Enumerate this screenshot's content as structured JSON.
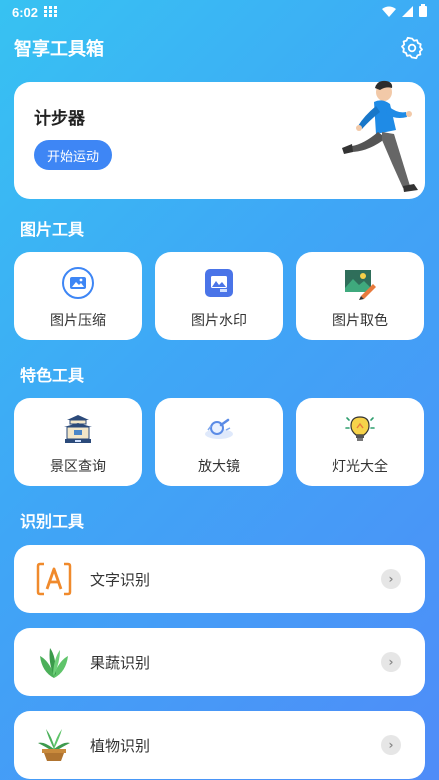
{
  "status_bar": {
    "time": "6:02"
  },
  "header": {
    "title": "智享工具箱",
    "settings_icon": "gear-icon"
  },
  "pedometer": {
    "title": "计步器",
    "button_label": "开始运动"
  },
  "image_tools": {
    "title": "图片工具",
    "items": [
      {
        "label": "图片压缩",
        "icon": "image-compress-icon"
      },
      {
        "label": "图片水印",
        "icon": "image-watermark-icon"
      },
      {
        "label": "图片取色",
        "icon": "color-picker-icon"
      }
    ]
  },
  "special_tools": {
    "title": "特色工具",
    "items": [
      {
        "label": "景区查询",
        "icon": "temple-icon"
      },
      {
        "label": "放大镜",
        "icon": "magnifier-icon"
      },
      {
        "label": "灯光大全",
        "icon": "lightbulb-icon"
      }
    ]
  },
  "recognition_tools": {
    "title": "识别工具",
    "items": [
      {
        "label": "文字识别",
        "icon": "text-scan-icon"
      },
      {
        "label": "果蔬识别",
        "icon": "vegetable-icon"
      },
      {
        "label": "植物识别",
        "icon": "potted-plant-icon"
      }
    ]
  },
  "colors": {
    "accent": "#3e86f5",
    "bg_start": "#37c2f2",
    "bg_end": "#4f8cf8"
  }
}
